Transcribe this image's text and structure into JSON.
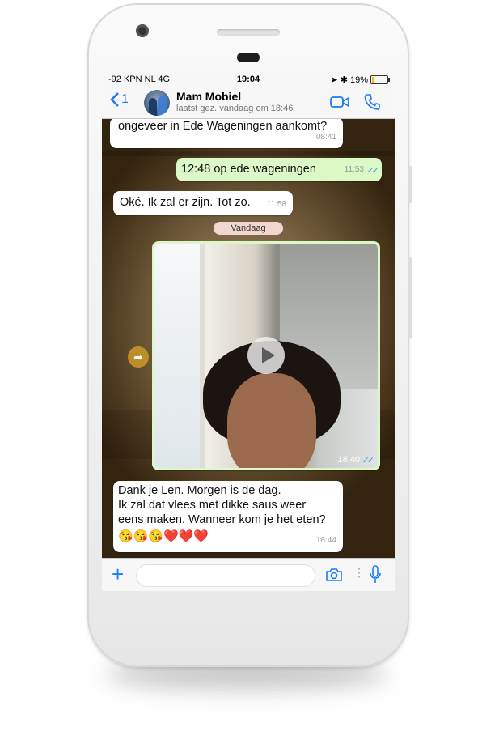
{
  "status_bar": {
    "carrier": "-92 KPN NL  4G",
    "time": "19:04",
    "battery": "19%",
    "battery_level": 0.19
  },
  "header": {
    "back_count": "1",
    "contact_name": "Mam Mobiel",
    "contact_status": "laatst gez. vandaag om 18:46",
    "icons": [
      "chevron-left-icon",
      "video-call-icon",
      "phone-icon"
    ],
    "accent_color": "#1a7cf5"
  },
  "messages": [
    {
      "direction": "in",
      "text": "ongeveer in Ede Wageningen  aankomt?",
      "time": "08:41"
    },
    {
      "direction": "out",
      "text": "12:48 op ede wageningen",
      "time": "11:53"
    },
    {
      "direction": "in",
      "text": "Oké. Ik zal er zijn. Tot zo.",
      "time": "11:58"
    }
  ],
  "date_separator": "Vandaag",
  "video_message": {
    "direction": "out",
    "time": "18:40"
  },
  "last_message": {
    "direction": "in",
    "lines": [
      "Dank je Len. Morgen is de dag.",
      "Ik zal dat vlees met dikke saus weer",
      "eens maken. Wanneer kom je het eten?"
    ],
    "emojis": "😘😘😘❤️❤️❤️",
    "time": "18:44"
  },
  "input_bar": {
    "icons": [
      "plus-icon",
      "camera-icon",
      "microphone-icon"
    ]
  },
  "colors": {
    "outgoing_bubble": "#dcf8c6",
    "incoming_bubble": "#ffffff",
    "read_ticks": "#3fa2e6"
  }
}
